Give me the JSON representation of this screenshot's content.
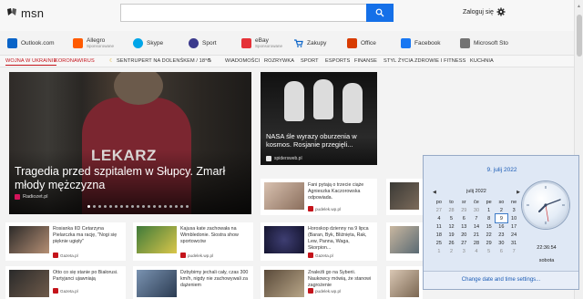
{
  "header": {
    "logo_text": "msn",
    "search_placeholder": "",
    "signin_label": "Zaloguj się"
  },
  "quick_links": [
    {
      "label": "Outlook.com",
      "sub": "",
      "color": "#0a64c8"
    },
    {
      "label": "Allegro",
      "sub": "Sponsorowane",
      "color": "#ff5a00"
    },
    {
      "label": "Skype",
      "sub": "",
      "color": "#00a5e8"
    },
    {
      "label": "Sport",
      "sub": "",
      "color": "#3b3a8c"
    },
    {
      "label": "eBay",
      "sub": "Sponsorowane",
      "color": "#e53238"
    },
    {
      "label": "Zakupy",
      "sub": "",
      "color": "#0a64c8"
    },
    {
      "label": "Office",
      "sub": "",
      "color": "#d83b01"
    },
    {
      "label": "Facebook",
      "sub": "",
      "color": "#1877f2"
    },
    {
      "label": "Microsoft Sto",
      "sub": "",
      "color": "#737373"
    }
  ],
  "nav": {
    "items": [
      "WOJNA W UKRAINIE",
      "KORONAWIRUS",
      "SENTRUPERT NA DOLENŚKEM / 18°C",
      "WIADOMOŚCI",
      "ROZRYWKA",
      "SPORT",
      "ESPORTS",
      "FINANSE",
      "STYL ŻYCIA",
      "ZDROWIE I FITNESS",
      "KUCHNIA"
    ]
  },
  "hero": {
    "title": "Tragedia przed szpitalem w Słupcy. Zmarł młody mężczyzna",
    "source": "Radiozet.pl",
    "jacket_text": "LEKARZ"
  },
  "nasa": {
    "title": "NASA śle wyrazy oburzenia w kosmos. Rosjanie przegięli...",
    "source": "spidersweb.pl"
  },
  "cards": [
    {
      "text": "Fani pytają o trzecie ciąże Agnieszka Kaczorowska odpowiada.",
      "source": "pudelek.wp.pl"
    },
    {
      "text": "Rosianka IID Cetarzyna Pielarczka ma rację, \"Nogi się pięknie ugięły\"",
      "source": "Gazeta.pl"
    },
    {
      "text": "Kajusa kate zachowała na Wimbledonie. Siostra show sportowców",
      "source": "pudelek.wp.pl"
    },
    {
      "text": "Horoskop dzienny na 9 lipca (Baran, Byk, Bliźnięta, Rak, Lew, Panna, Waga, Skorpion...",
      "source": "Gazeta.pl"
    },
    {
      "text": "Otto co się stanie po Białorusi. Partyjanci ujawniają",
      "source": "Gazeta.pl"
    },
    {
      "text": "Dzbybimy jechali cały, czas 300 km/h, nigdy nie zachowywali za dążeniem",
      "source": ""
    },
    {
      "text": "Znaleźli go na Syberii. Naukowcy mówią, że stanowi zagrożenie",
      "source": "pudelek.wp.pl"
    }
  ],
  "calendar": {
    "full_date": "9. julij 2022",
    "month_label": "julij 2022",
    "weekdays": [
      "po",
      "to",
      "sr",
      "če",
      "pe",
      "so",
      "ne"
    ],
    "weeks": [
      [
        "27",
        "28",
        "29",
        "30",
        "1",
        "2",
        "3"
      ],
      [
        "4",
        "5",
        "6",
        "7",
        "8",
        "9",
        "10"
      ],
      [
        "11",
        "12",
        "13",
        "14",
        "15",
        "16",
        "17"
      ],
      [
        "18",
        "19",
        "20",
        "21",
        "22",
        "23",
        "24"
      ],
      [
        "25",
        "26",
        "27",
        "28",
        "29",
        "30",
        "31"
      ],
      [
        "1",
        "2",
        "3",
        "4",
        "5",
        "6",
        "7"
      ]
    ],
    "time": "22:36:54",
    "day_name": "sobota",
    "footer_link": "Change date and time settings..."
  }
}
